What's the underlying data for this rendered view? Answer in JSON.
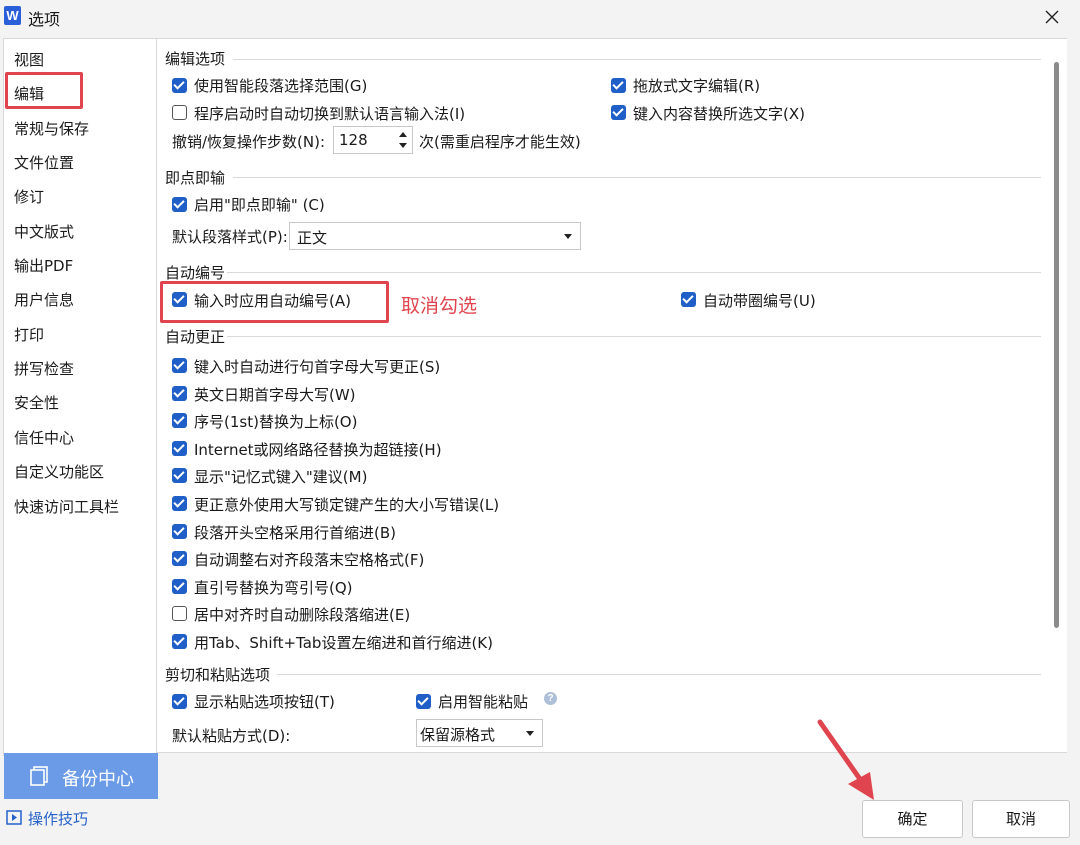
{
  "window": {
    "app_icon_letter": "W",
    "title": "选项"
  },
  "sidebar": {
    "items": [
      {
        "label": "视图"
      },
      {
        "label": "编辑"
      },
      {
        "label": "常规与保存"
      },
      {
        "label": "文件位置"
      },
      {
        "label": "修订"
      },
      {
        "label": "中文版式"
      },
      {
        "label": "输出PDF"
      },
      {
        "label": "用户信息"
      },
      {
        "label": "打印"
      },
      {
        "label": "拼写检查"
      },
      {
        "label": "安全性"
      },
      {
        "label": "信任中心"
      },
      {
        "label": "自定义功能区"
      },
      {
        "label": "快速访问工具栏"
      }
    ],
    "selected": "编辑",
    "backup_label": "备份中心",
    "tips_label": "操作技巧"
  },
  "edit_options": {
    "heading": "编辑选项",
    "smart_select": {
      "label": "使用智能段落选择范围(G)",
      "checked": true
    },
    "auto_switch_ime": {
      "label": "程序启动时自动切换到默认语言输入法(I)",
      "checked": false
    },
    "drag_drop": {
      "label": "拖放式文字编辑(R)",
      "checked": true
    },
    "typing_replaces": {
      "label": "键入内容替换所选文字(X)",
      "checked": true
    },
    "undo_label": "撤销/恢复操作步数(N):",
    "undo_value": "128",
    "undo_suffix": "次(需重启程序才能生效)"
  },
  "click_and_type": {
    "heading": "即点即输",
    "enable": {
      "label": "启用\"即点即输\" (C)",
      "checked": true
    },
    "style_label": "默认段落样式(P):",
    "style_value": "正文"
  },
  "auto_numbering": {
    "heading": "自动编号",
    "apply_on_input": {
      "label": "输入时应用自动编号(A)",
      "checked": true
    },
    "circled_numbers": {
      "label": "自动带圈编号(U)",
      "checked": true
    },
    "annotation": "取消勾选"
  },
  "autocorrect": {
    "heading": "自动更正",
    "items": [
      {
        "label": "键入时自动进行句首字母大写更正(S)",
        "checked": true
      },
      {
        "label": "英文日期首字母大写(W)",
        "checked": true
      },
      {
        "label": "序号(1st)替换为上标(O)",
        "checked": true
      },
      {
        "label": "Internet或网络路径替换为超链接(H)",
        "checked": true
      },
      {
        "label": "显示\"记忆式键入\"建议(M)",
        "checked": true
      },
      {
        "label": "更正意外使用大写锁定键产生的大小写错误(L)",
        "checked": true
      },
      {
        "label": "段落开头空格采用行首缩进(B)",
        "checked": true
      },
      {
        "label": "自动调整右对齐段落末空格格式(F)",
        "checked": true
      },
      {
        "label": "直引号替换为弯引号(Q)",
        "checked": true
      },
      {
        "label": "居中对齐时自动删除段落缩进(E)",
        "checked": false
      },
      {
        "label": "用Tab、Shift+Tab设置左缩进和首行缩进(K)",
        "checked": true
      }
    ]
  },
  "cut_paste": {
    "heading": "剪切和粘贴选项",
    "show_paste_btn": {
      "label": "显示粘贴选项按钮(T)",
      "checked": true
    },
    "smart_paste": {
      "label": "启用智能粘贴",
      "checked": true
    },
    "default_paste_label": "默认粘贴方式(D):",
    "default_paste_value": "保留源格式"
  },
  "buttons": {
    "ok": "确定",
    "cancel": "取消"
  },
  "colors": {
    "accent": "#1f5fc7",
    "annotation": "#e0454f",
    "backup_bg": "#6b9be6",
    "link": "#2461c9"
  }
}
